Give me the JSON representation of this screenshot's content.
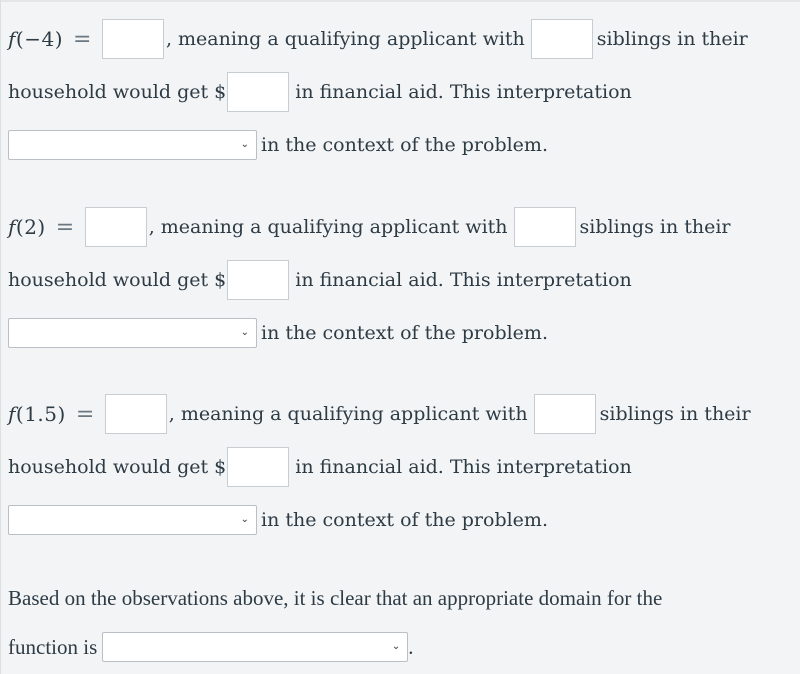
{
  "questions": [
    {
      "expr_fn": "f",
      "expr_arg": "(−4)",
      "eq": "=",
      "text_meaning": ", meaning a qualifying applicant with",
      "text_siblings": "siblings in their",
      "text_household": "household would get $",
      "text_aid": "in financial aid. This interpretation",
      "text_context": "in the context of the problem.",
      "value_input": "",
      "siblings_input": "",
      "aid_input": "",
      "interpretation_select": ""
    },
    {
      "expr_fn": "f",
      "expr_arg": "(2)",
      "eq": "=",
      "text_meaning": ", meaning a qualifying applicant with",
      "text_siblings": "siblings in their",
      "text_household": "household would get $",
      "text_aid": "in financial aid. This interpretation",
      "text_context": "in the context of the problem.",
      "value_input": "",
      "siblings_input": "",
      "aid_input": "",
      "interpretation_select": ""
    },
    {
      "expr_fn": "f",
      "expr_arg": "(1.5)",
      "eq": "=",
      "text_meaning": ", meaning a qualifying applicant with",
      "text_siblings": "siblings in their",
      "text_household": "household would get $",
      "text_aid": "in financial aid. This interpretation",
      "text_context": "in the context of the problem.",
      "value_input": "",
      "siblings_input": "",
      "aid_input": "",
      "interpretation_select": ""
    }
  ],
  "conclusion": {
    "line1": "Based on the observations above, it is clear that an appropriate domain for the",
    "line2": "function is",
    "end": ".",
    "domain_select": ""
  },
  "icons": {
    "dropdown": "⌄"
  }
}
